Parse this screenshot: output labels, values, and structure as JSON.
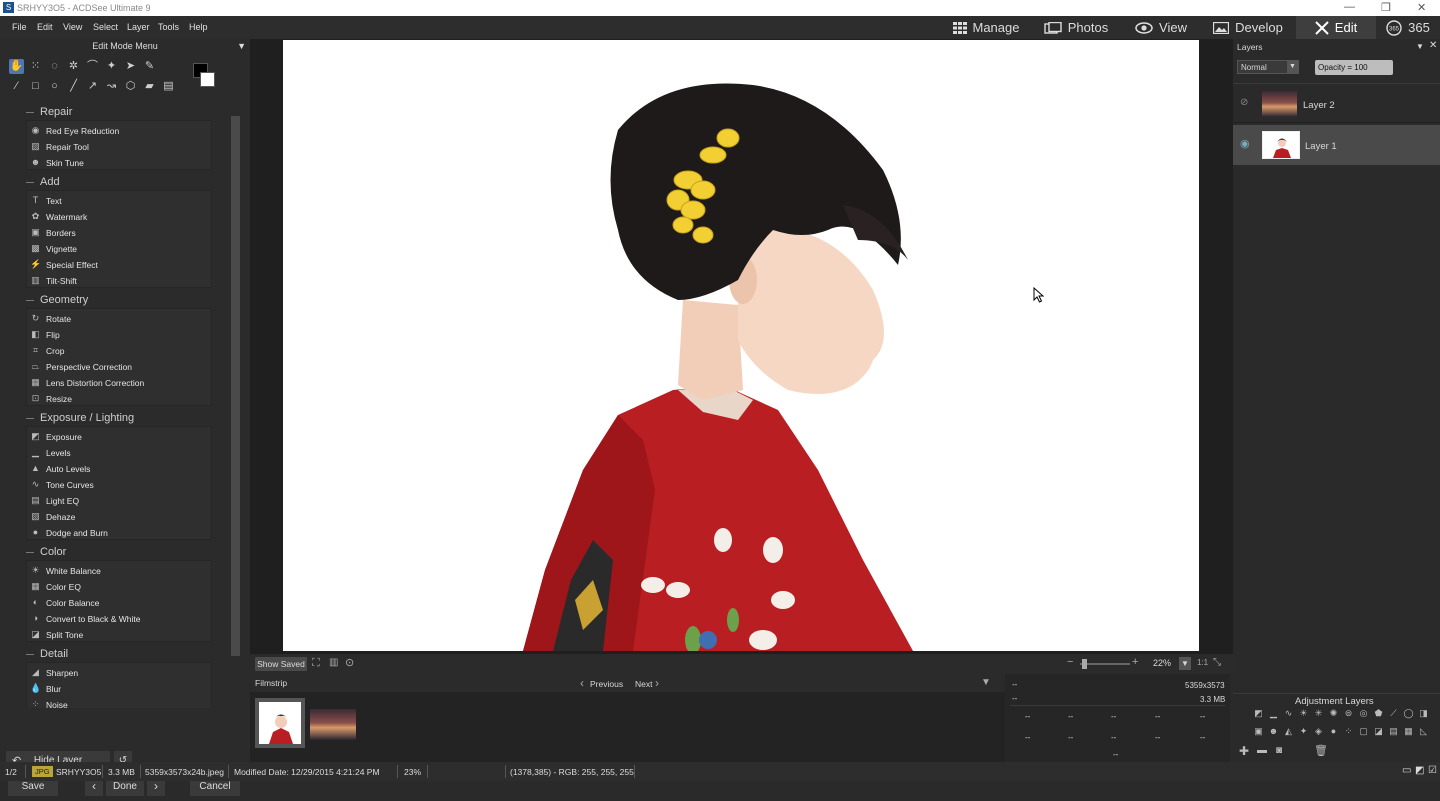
{
  "window": {
    "app_icon": "S",
    "title": "SRHYY3O5 - ACDSee Ultimate 9",
    "minimize": "—",
    "restore": "❐",
    "close": "✕"
  },
  "menu": [
    "File",
    "Edit",
    "View",
    "Select",
    "Layer",
    "Tools",
    "Help"
  ],
  "modes": [
    {
      "label": "Manage",
      "icon": "grid-icon"
    },
    {
      "label": "Photos",
      "icon": "photos-icon"
    },
    {
      "label": "View",
      "icon": "eye-icon"
    },
    {
      "label": "Develop",
      "icon": "develop-icon"
    },
    {
      "label": "Edit",
      "icon": "edit-icon",
      "active": true
    },
    {
      "label": "365",
      "icon": "cloud-365-icon"
    }
  ],
  "left_panel": {
    "title": "Edit Mode Menu",
    "dropdown_glyph": "▼",
    "groups": [
      {
        "name": "Repair",
        "items": [
          "Red Eye Reduction",
          "Repair Tool",
          "Skin Tune"
        ]
      },
      {
        "name": "Add",
        "items": [
          "Text",
          "Watermark",
          "Borders",
          "Vignette",
          "Special Effect",
          "Tilt-Shift"
        ]
      },
      {
        "name": "Geometry",
        "items": [
          "Rotate",
          "Flip",
          "Crop",
          "Perspective Correction",
          "Lens Distortion Correction",
          "Resize"
        ]
      },
      {
        "name": "Exposure / Lighting",
        "items": [
          "Exposure",
          "Levels",
          "Auto Levels",
          "Tone Curves",
          "Light EQ",
          "Dehaze",
          "Dodge and Burn"
        ]
      },
      {
        "name": "Color",
        "items": [
          "White Balance",
          "Color EQ",
          "Color Balance",
          "Convert to Black & White",
          "Split Tone"
        ]
      },
      {
        "name": "Detail",
        "items": [
          "Sharpen",
          "Blur",
          "Noise"
        ]
      }
    ],
    "hide_layer": "Hide Layer",
    "save": "Save",
    "done": "Done",
    "cancel": "Cancel"
  },
  "viewbar": {
    "show_saved": "Show Saved",
    "zoom": "22%",
    "ratio": "1:1"
  },
  "filmstrip": {
    "label": "Filmstrip",
    "previous": "Previous",
    "next": "Next"
  },
  "info": {
    "dash": "--",
    "dimensions": "5359x3573",
    "size": "3.3 MB"
  },
  "layers": {
    "title": "Layers",
    "blend_mode": "Normal",
    "opacity": "Opacity = 100",
    "items": [
      {
        "name": "Layer 2"
      },
      {
        "name": "Layer 1",
        "selected": true
      }
    ],
    "adjustment_title": "Adjustment Layers"
  },
  "status": {
    "index": "1/2",
    "type": "JPG",
    "filename": "SRHYY3O5",
    "filesize": "3.3 MB",
    "dims": "5359x3573x24b.jpeg",
    "modified": "Modified Date: 12/29/2015 4:21:24 PM",
    "zoom": "23%",
    "pixel": "(1378,385) - RGB: 255, 255, 255"
  },
  "colors": {
    "accent": "#4a78b5",
    "kimono": "#b81e22",
    "flower": "#f2d033"
  }
}
